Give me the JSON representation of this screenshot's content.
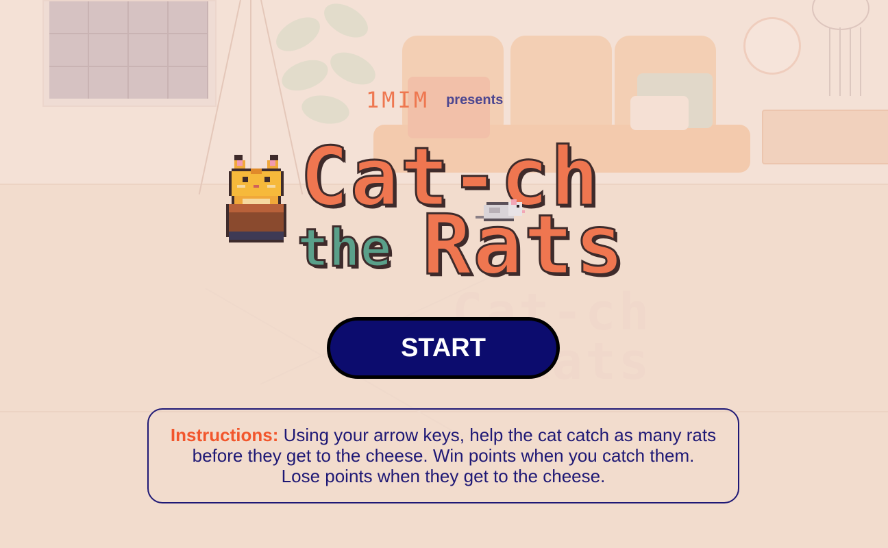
{
  "presents": {
    "brand": "1MIM",
    "word": "presents"
  },
  "title": {
    "line1": "Cat-ch",
    "line2_small": "the",
    "line2_large": "Rats"
  },
  "start_button": {
    "label": "START"
  },
  "instructions": {
    "label": "Instructions:",
    "line1": "Using your arrow keys, help the cat catch as many rats",
    "line2": "before they get to the cheese. Win points when you catch them.",
    "line3": "Lose points when they get to the cheese."
  },
  "colors": {
    "background": "#f4e1d6",
    "title_orange": "#ef7650",
    "title_green": "#5aa08a",
    "button_fill": "#0c0c6e",
    "instruction_text": "#1e1875",
    "instruction_label": "#f2562c"
  },
  "icons": {
    "cat": "pixel-cat-sprite",
    "rat": "pixel-rat-sprite"
  }
}
